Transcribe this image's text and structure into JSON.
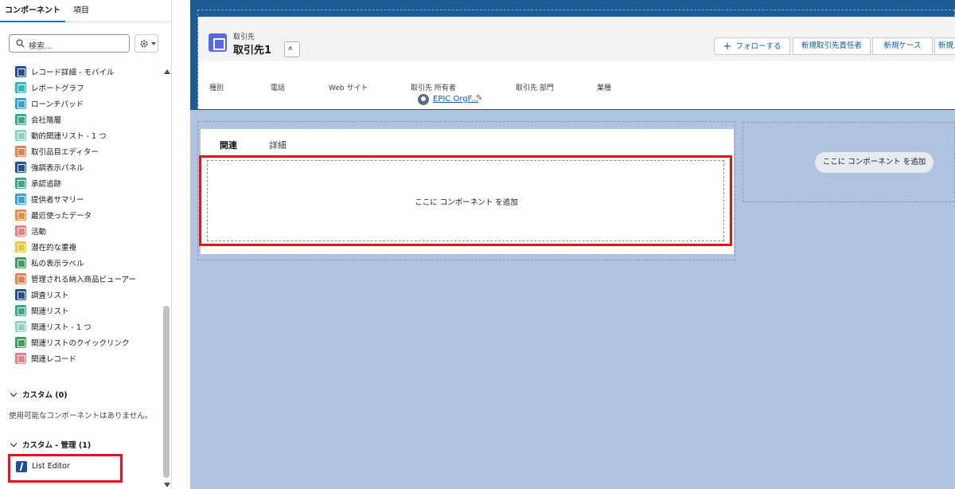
{
  "left_panel": {
    "tabs": [
      "コンポーネント",
      "項目"
    ],
    "search_placeholder": "検索...",
    "components": [
      {
        "label": "レコード詳細 - モバイル",
        "icon": "record-detail-icon",
        "color": "#1b5297"
      },
      {
        "label": "レポートグラフ",
        "icon": "chart-icon",
        "color": "#2fb5c9"
      },
      {
        "label": "ローンチパッド",
        "icon": "grid-icon",
        "color": "#3b9ede"
      },
      {
        "label": "会社階層",
        "icon": "hierarchy-icon",
        "color": "#3ba88f"
      },
      {
        "label": "動的関連リスト - 1 つ",
        "icon": "related-list-icon",
        "color": "#8fd3c3"
      },
      {
        "label": "取引品目エディター",
        "icon": "product-editor-icon",
        "color": "#ef7d4f"
      },
      {
        "label": "強調表示パネル",
        "icon": "highlights-icon",
        "color": "#1b5297"
      },
      {
        "label": "承認追跡",
        "icon": "approval-icon",
        "color": "#3ba88f"
      },
      {
        "label": "提供者サマリー",
        "icon": "provider-icon",
        "color": "#3b9ede"
      },
      {
        "label": "最近使ったデータ",
        "icon": "clock-icon",
        "color": "#f28b3d"
      },
      {
        "label": "活動",
        "icon": "activity-icon",
        "color": "#ef7d80"
      },
      {
        "label": "潜在的な重複",
        "icon": "duplicate-icon",
        "color": "#f3c33a"
      },
      {
        "label": "私の表示ラベル",
        "icon": "label-icon",
        "color": "#3aa15c"
      },
      {
        "label": "管理される納入商品ビューアー",
        "icon": "asset-viewer-icon",
        "color": "#ef7d4f"
      },
      {
        "label": "調査リスト",
        "icon": "checklist-icon",
        "color": "#1b5297"
      },
      {
        "label": "関連リスト",
        "icon": "related-list-icon",
        "color": "#3ba88f"
      },
      {
        "label": "関連リスト - 1 つ",
        "icon": "related-list-icon",
        "color": "#8fd3c3"
      },
      {
        "label": "関連リストのクイックリンク",
        "icon": "quicklink-icon",
        "color": "#3aa15c"
      },
      {
        "label": "関連レコード",
        "icon": "related-record-icon",
        "color": "#ef7d80"
      }
    ],
    "custom_section": "カスタム (0)",
    "custom_empty": "使用可能なコンポーネントはありません。",
    "custom_managed_section": "カスタム - 管理 (1)",
    "custom_managed_item": "List Editor"
  },
  "record": {
    "object_type": "取引先",
    "record_name": "取引先1",
    "actions": {
      "follow": "フォローする",
      "new_contact": "新規取引先責任者",
      "new_case": "新規ケース",
      "more": "新規メ"
    },
    "fields": [
      "種別",
      "電話",
      "Web サイト",
      "取引先 所有者",
      "取引先 部門",
      "業種"
    ],
    "owner_name": "EPIC OrgF..."
  },
  "main": {
    "tabs": [
      "関連",
      "詳細"
    ],
    "dropzone_text": "ここに コンポーネント を追加"
  },
  "side": {
    "dropzone_text": "ここに コンポーネント を追加"
  },
  "colors": {
    "accent": "#0176d3",
    "highlight": "#e3141b",
    "canvas": "#b0c4df"
  }
}
